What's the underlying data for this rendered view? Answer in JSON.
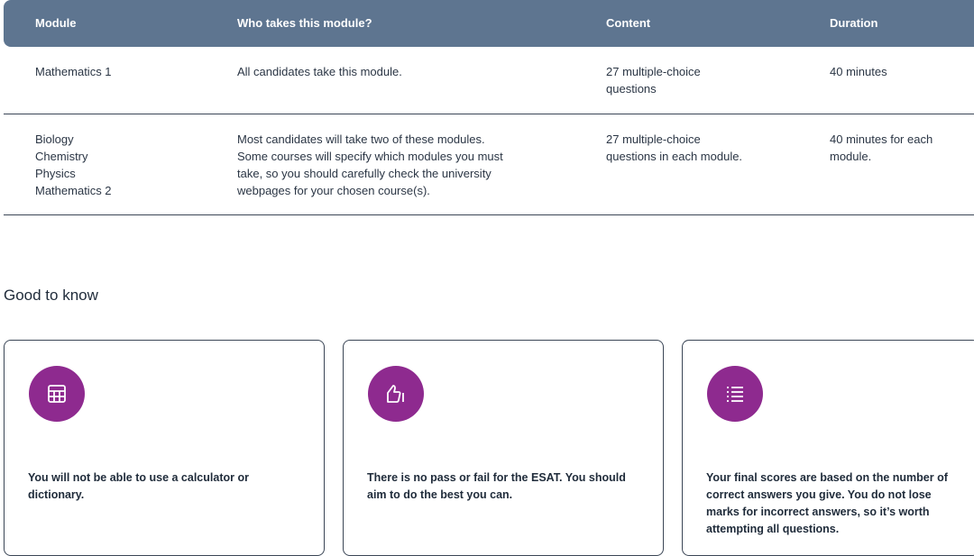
{
  "table": {
    "headers": {
      "module": "Module",
      "who": "Who takes this module?",
      "content": "Content",
      "duration": "Duration"
    },
    "rows": [
      {
        "module": [
          "Mathematics 1"
        ],
        "who": [
          "All candidates take this module."
        ],
        "content": [
          "27 multiple-choice",
          "questions"
        ],
        "duration": [
          "40 minutes"
        ]
      },
      {
        "module": [
          "Biology",
          "Chemistry",
          "Physics",
          "Mathematics 2"
        ],
        "who": [
          "Most candidates will take two of these modules.",
          "Some courses will specify which modules you must",
          "take, so you should carefully check the university",
          "webpages for your chosen course(s)."
        ],
        "content": [
          "27 multiple-choice",
          "questions in each module."
        ],
        "duration": [
          "40 minutes for each",
          "module."
        ]
      }
    ]
  },
  "good_to_know": {
    "title": "Good to know",
    "cards": [
      {
        "icon": "calculator-icon",
        "text": [
          "You will not be able to use a calculator or",
          "dictionary."
        ]
      },
      {
        "icon": "thumbs-up-icon",
        "text": [
          "There is no pass or fail for the ESAT. You should",
          "aim to do the best you can."
        ]
      },
      {
        "icon": "list-icon",
        "text": [
          "Your final scores are based on the number of",
          "correct answers you give. You do not lose",
          "marks for incorrect answers, so it’s worth",
          "attempting all questions."
        ]
      }
    ]
  },
  "colors": {
    "header_bg": "#5e7590",
    "icon_bg": "#8e2a8f",
    "border": "#3b4656"
  }
}
